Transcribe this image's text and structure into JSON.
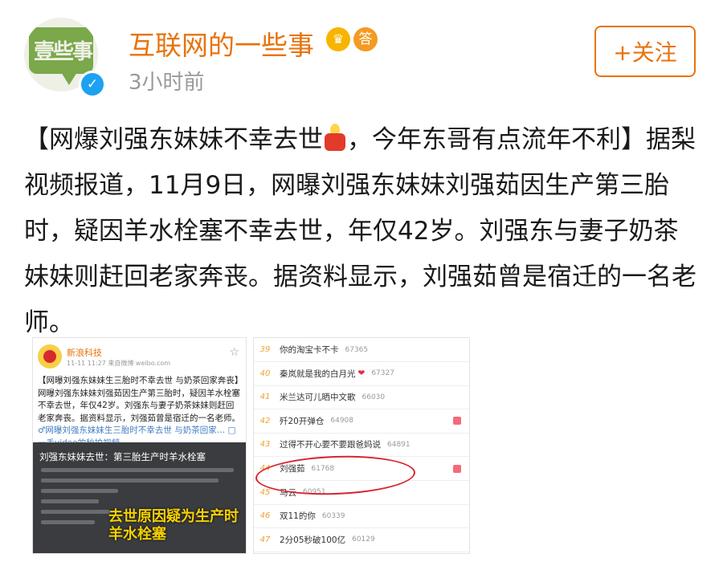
{
  "post": {
    "username": "互联网的一些事",
    "time": "3小时前",
    "follow_label": "+关注",
    "avatar_text": "壹些事",
    "badges": {
      "crown": "crown-icon",
      "answer": "答"
    },
    "text_part1": "【网爆刘强东妹妹不幸去世",
    "text_part2": "，今年东哥有点流年不利】据梨视频报道，11月9日，网曝刘强东妹妹刘强茹因生产第三胎时，疑因羊水栓塞不幸去世，年仅42岁。刘强东与妻子奶茶妹妹则赶回老家奔丧。据资料显示，刘强茹曾是宿迁的一名老师。"
  },
  "left_image": {
    "account": "新浪科技",
    "meta": "11-11 11:27 来自微博 weibo.com",
    "text": "【网曝刘强东妹妹生三胎时不幸去世 与奶茶回家奔丧】网曝刘强东妹妹刘强茹因生产第三胎时，疑因羊水栓塞不幸去世，年仅42岁。刘强东与妻子奶茶妹妹则赶回老家奔丧。据资料显示，刘强茹曾是宿迁的一名老师。",
    "link": "♂网曝刘强东妹妹生三胎时不幸去世 与奶茶回家…",
    "video_link": "□一手video的秒拍视频",
    "video_title": "刘强东妹妹去世：第三胎生产时羊水栓塞",
    "video_caption": "去世原因疑为生产时羊水栓塞"
  },
  "trending": [
    {
      "rank": "39",
      "title": "你的淘宝卡不卡",
      "count": "67365",
      "badge": false,
      "heart": false
    },
    {
      "rank": "40",
      "title": "秦岚就是我的白月光",
      "count": "67327",
      "badge": false,
      "heart": true
    },
    {
      "rank": "41",
      "title": "米兰达可儿晒中文歌",
      "count": "66030",
      "badge": false,
      "heart": false
    },
    {
      "rank": "42",
      "title": "歼20开弹仓",
      "count": "64908",
      "badge": true,
      "heart": false
    },
    {
      "rank": "43",
      "title": "过得不开心要不要跟爸妈说",
      "count": "64891",
      "badge": false,
      "heart": false
    },
    {
      "rank": "44",
      "title": "刘强茹",
      "count": "61768",
      "badge": true,
      "heart": false
    },
    {
      "rank": "45",
      "title": "马云",
      "count": "60951",
      "badge": false,
      "heart": false
    },
    {
      "rank": "46",
      "title": "双11的你",
      "count": "60339",
      "badge": false,
      "heart": false
    },
    {
      "rank": "47",
      "title": "2分05秒破100亿",
      "count": "60129",
      "badge": false,
      "heart": false
    }
  ],
  "colors": {
    "accent": "#e8730c",
    "link": "#3f7cc4",
    "highlight_circle": "#d8242f"
  }
}
